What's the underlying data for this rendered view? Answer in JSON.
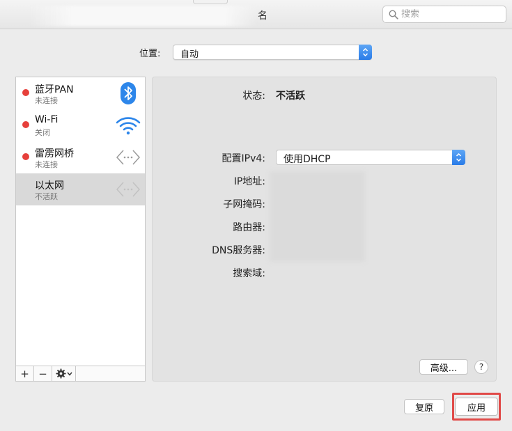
{
  "window": {
    "title_suffix": "名",
    "search_placeholder": "搜索"
  },
  "location": {
    "label": "位置:",
    "value": "自动"
  },
  "services": [
    {
      "name": "蓝牙PAN",
      "status": "未连接",
      "icon": "bluetooth-icon",
      "dot": "#e6403b"
    },
    {
      "name": "Wi-Fi",
      "status": "关闭",
      "icon": "wifi-icon",
      "dot": "#e6403b"
    },
    {
      "name": "雷雳网桥",
      "status": "未连接",
      "icon": "ethernet-arrows-icon",
      "dot": "#e6403b"
    },
    {
      "name": "以太网",
      "status": "不活跃",
      "icon": "ethernet-arrows-icon",
      "selected": true
    }
  ],
  "sidebar_toolbar": {
    "add": "+",
    "remove": "−",
    "gear": "gear-icon",
    "chevron": "chevron-down-icon"
  },
  "detail": {
    "status_label": "状态:",
    "status_value": "不活跃",
    "config_ipv4_label": "配置IPv4:",
    "config_ipv4_value": "使用DHCP",
    "ip_label": "IP地址:",
    "subnet_label": "子网掩码:",
    "router_label": "路由器:",
    "dns_label": "DNS服务器:",
    "search_domain_label": "搜索域:",
    "advanced_button": "高级...",
    "help_button": "?"
  },
  "footer": {
    "revert_button": "复原",
    "apply_button": "应用"
  },
  "colors": {
    "accent": "#2a7ce8",
    "status_dot": "#e6403b",
    "highlight": "#e04a48"
  }
}
